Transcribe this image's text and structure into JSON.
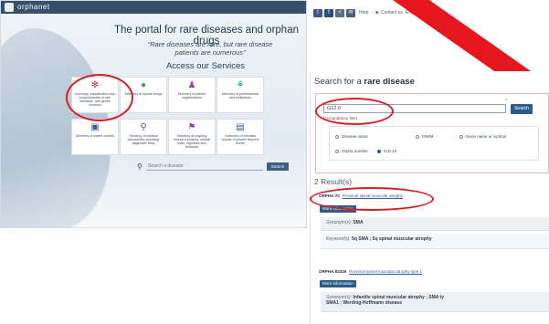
{
  "home": {
    "logo": "orphanet",
    "title": "The portal for rare diseases and orphan drugs",
    "tagline_1": "“Rare diseases are rare, but rare disease",
    "tagline_2": "patients are numerous”",
    "access": "Access our Services",
    "tiles": [
      {
        "label": "Inventory, classification and encyclopaedia of rare diseases, with genes involved",
        "icon": "dna-icon",
        "color": "#c0392b"
      },
      {
        "label": "Directory of orphan drugs",
        "icon": "pills-icon",
        "color": "#43a047"
      },
      {
        "label": "Directory of patient organisations",
        "icon": "people-icon",
        "color": "#8e44ad"
      },
      {
        "label": "Directory of professionals and institutions",
        "icon": "doctor-icon",
        "color": "#0d8a8a"
      },
      {
        "label": "Directory of expert centres",
        "icon": "building-icon",
        "color": "#2e5d99"
      },
      {
        "label": "Directory of medical laboratories providing diagnostic tests",
        "icon": "test-tube-icon",
        "color": "#6a3fa0"
      },
      {
        "label": "Directory of ongoing research projects, clinical trials, registries and biobanks",
        "icon": "microscope-icon",
        "color": "#8e44ad"
      },
      {
        "label": "Collection of thematic reports Orphanet Reports Series",
        "icon": "book-icon",
        "color": "#2e5d99"
      }
    ],
    "search_placeholder": "Search a disease",
    "search_button": "Search"
  },
  "toolbar": {
    "help": "Help",
    "contact": "Contact us",
    "language": "EN"
  },
  "search": {
    "title_prefix": "Search for a ",
    "title_bold": "rare disease",
    "query": "G12.0",
    "button": "Search",
    "required_marker": "*",
    "mandatory": "(*) mandatory field",
    "options": [
      {
        "label": "Disease name",
        "selected": false
      },
      {
        "label": "OMIM",
        "selected": false
      },
      {
        "label": "Gene name or symbol",
        "selected": false
      },
      {
        "label": "Orpha number",
        "selected": false
      },
      {
        "label": "ICD-10",
        "selected": true
      }
    ]
  },
  "results": {
    "count": "2 Result(s)",
    "items": [
      {
        "id": "ORPHA:70",
        "name": "Proximal spinal muscular atrophy",
        "more": "More information",
        "synonyms_label": "Synonym(s):",
        "synonyms": "SMA",
        "keywords_label": "Keyword(s):",
        "keywords": "5q SMA ; 5q spinal muscular atrophy"
      },
      {
        "id": "ORPHA:83330",
        "name": "Proximal spinal muscular atrophy type 1",
        "more": "More information",
        "synonyms_label": "Synonym(s):",
        "synonyms": "Infantile spinal muscular atrophy ; SMA ty",
        "synonyms_2": "SMA1 ; Werdnig-Hoffmann disease"
      }
    ]
  },
  "colors": {
    "annotation": "#d91f26",
    "primary": "#2b5c8c"
  }
}
